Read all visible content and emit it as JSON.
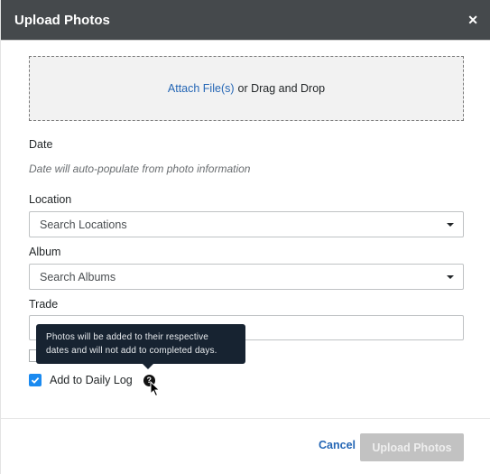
{
  "header": {
    "title": "Upload Photos",
    "close_icon": "close-icon"
  },
  "dropzone": {
    "link_label": "Attach File(s)",
    "rest_label": "or Drag and Drop"
  },
  "date": {
    "label": "Date",
    "hint": "Date will auto-populate from photo information"
  },
  "location": {
    "label": "Location",
    "placeholder": "Search Locations"
  },
  "album": {
    "label": "Album",
    "placeholder": "Search Albums"
  },
  "trade": {
    "label": "Trade",
    "value": ""
  },
  "options": {
    "hidden_checkbox_checked": false,
    "daily_log": {
      "label": "Add to Daily Log",
      "checked": true
    }
  },
  "tooltip": {
    "text_line1": "Photos will be added to their respective",
    "text_line2": "dates and will not add to completed days."
  },
  "footer": {
    "cancel_label": "Cancel",
    "upload_label": "Upload Photos",
    "upload_disabled": true
  },
  "colors": {
    "header_bg": "#45494c",
    "link": "#2466b5",
    "checkbox": "#1a8af0",
    "tooltip_bg": "#172331",
    "disabled_button": "#c2c2c2"
  }
}
